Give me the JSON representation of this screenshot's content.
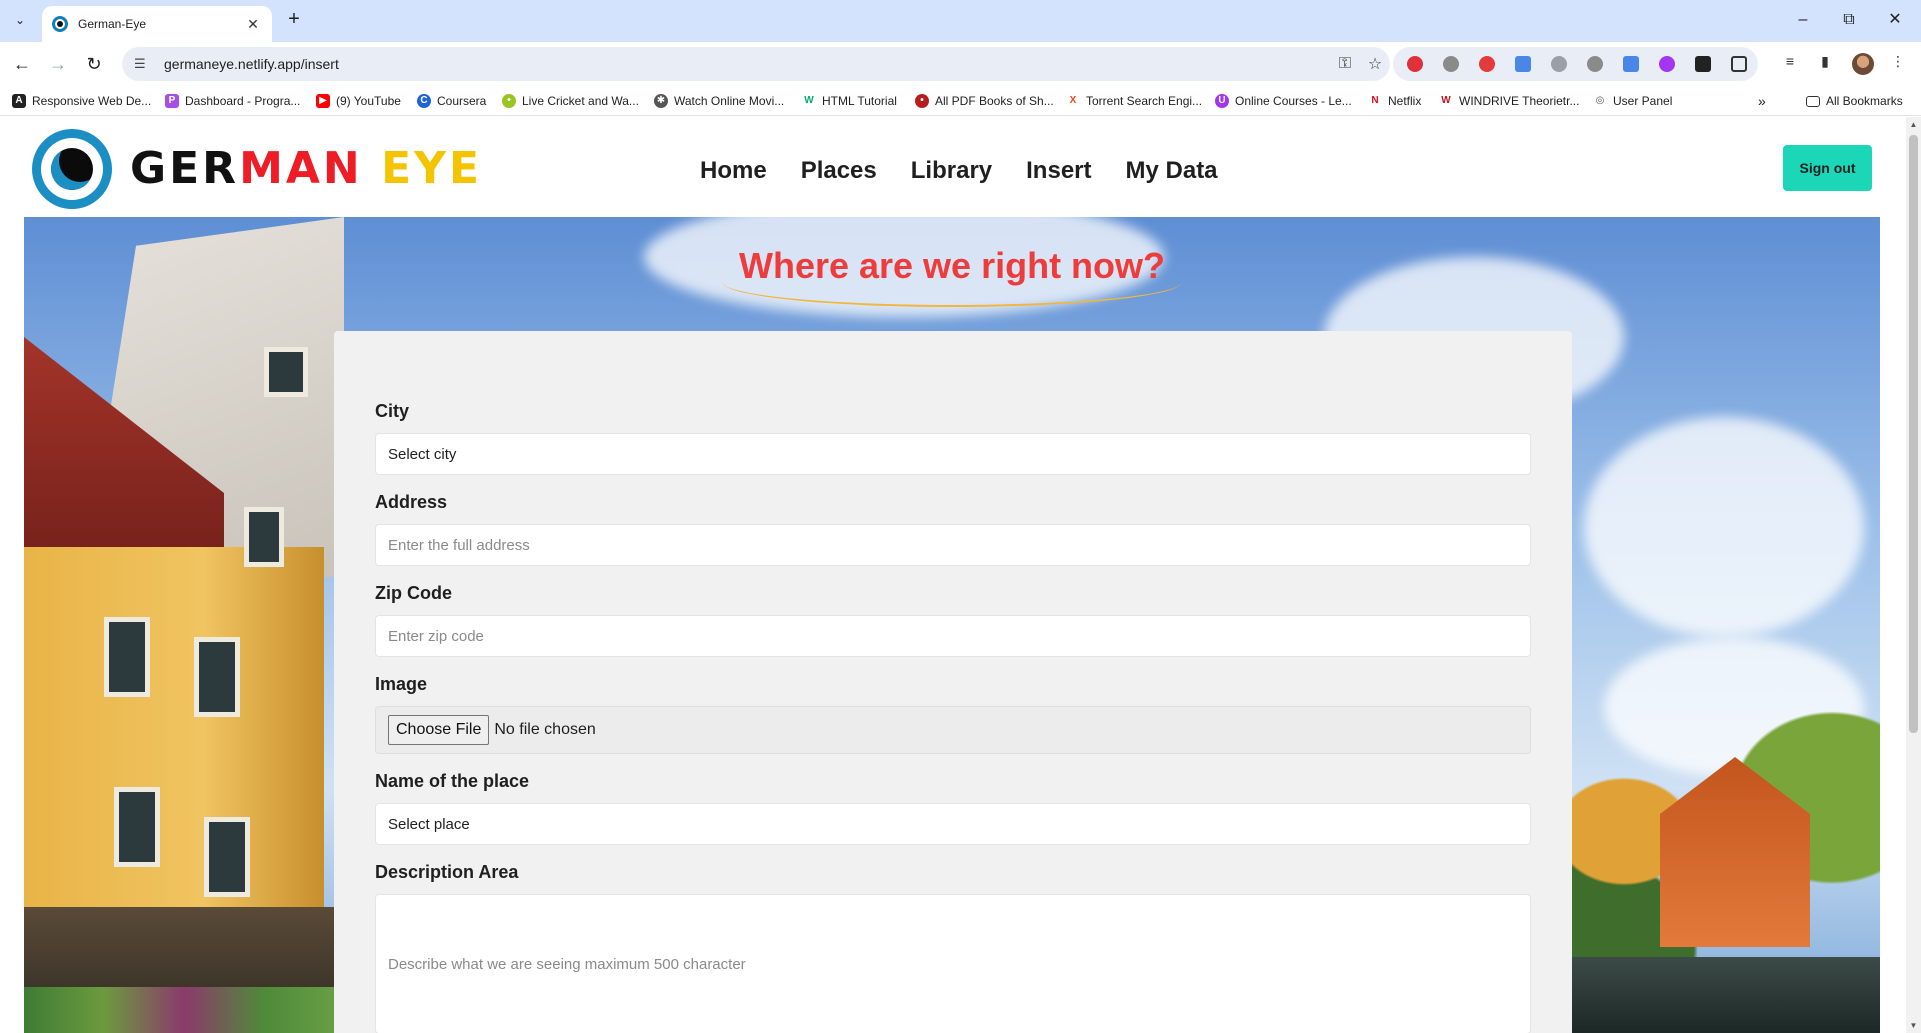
{
  "browser": {
    "tab_title": "German-Eye",
    "url": "germaneye.netlify.app/insert",
    "all_bookmarks": "All Bookmarks",
    "bookmarks": [
      {
        "label": "Responsive Web De...",
        "color": "#222222",
        "glyph": "A"
      },
      {
        "label": "Dashboard - Progra...",
        "color": "#a54ee3",
        "glyph": "P"
      },
      {
        "label": "(9) YouTube",
        "color": "#ff0000",
        "glyph": "▶"
      },
      {
        "label": "Coursera",
        "color": "#1d64d8",
        "glyph": "C"
      },
      {
        "label": "Live Cricket and Wa...",
        "color": "#9ac421",
        "glyph": "•"
      },
      {
        "label": "Watch Online Movi...",
        "color": "#555555",
        "glyph": "✱"
      },
      {
        "label": "HTML Tutorial",
        "color": "#04aa6d",
        "glyph": "W"
      },
      {
        "label": "All PDF Books of Sh...",
        "color": "#b61e1e",
        "glyph": "•"
      },
      {
        "label": "Torrent Search Engi...",
        "color": "#e8471e",
        "glyph": "X"
      },
      {
        "label": "Online Courses - Le...",
        "color": "#a435f0",
        "glyph": "U"
      },
      {
        "label": "Netflix",
        "color": "#e50914",
        "glyph": "N"
      },
      {
        "label": "WINDRIVE Theorietr...",
        "color": "#c0111f",
        "glyph": "W"
      },
      {
        "label": "User Panel",
        "color": "#555555",
        "glyph": "◎"
      }
    ]
  },
  "site": {
    "logo": {
      "part1": "GER",
      "part2": "MAN",
      "part3": "EYE"
    },
    "nav": [
      "Home",
      "Places",
      "Library",
      "Insert",
      "My Data"
    ],
    "sign_out": "Sign out",
    "hero_title": "Where are we right now?"
  },
  "form": {
    "city": {
      "label": "City",
      "value": "Select city"
    },
    "address": {
      "label": "Address",
      "placeholder": "Enter the full address"
    },
    "zip": {
      "label": "Zip Code",
      "placeholder": "Enter zip code"
    },
    "image": {
      "label": "Image",
      "button": "Choose File",
      "status": "No file chosen"
    },
    "place": {
      "label": "Name of the place",
      "value": "Select place"
    },
    "description": {
      "label": "Description Area",
      "placeholder": "Describe what we are seeing maximum 500 character"
    }
  },
  "colors": {
    "accent_teal": "#1cd6b8",
    "hero_title_red": "#ee3b3b",
    "logo_red": "#ee1c24",
    "logo_yellow": "#f5c400",
    "logo_blue": "#1b8fc4"
  }
}
